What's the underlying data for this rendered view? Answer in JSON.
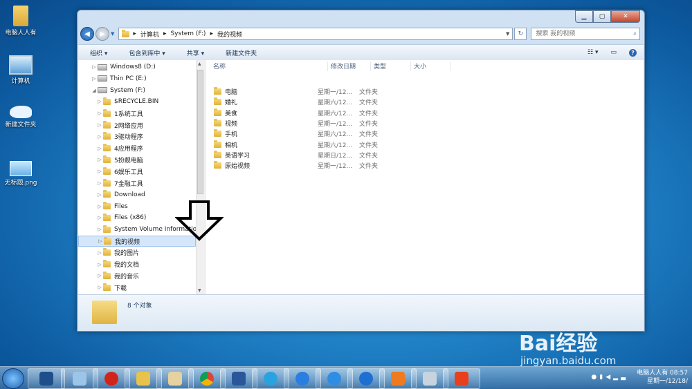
{
  "desktop": {
    "icons": [
      {
        "label": "电脑人人有"
      },
      {
        "label": "计算机"
      },
      {
        "label": "新建文件夹"
      },
      {
        "label": "无标题.png"
      }
    ]
  },
  "window": {
    "caption_buttons": [
      "minimize-icon",
      "maximize-icon",
      "close-icon"
    ],
    "address": {
      "crumbs": [
        "计算机",
        "System (F:)",
        "我的视频"
      ]
    },
    "search": {
      "placeholder": "搜索 我的视频"
    },
    "toolbar": {
      "organize": "组织 ▾",
      "include_library": "包含到库中 ▾",
      "share": "共享 ▾",
      "new_folder": "新建文件夹"
    },
    "nav_tree": [
      {
        "label": "Windows8 (D:)",
        "type": "drive",
        "indent": 1
      },
      {
        "label": "Thin PC (E:)",
        "type": "drive",
        "indent": 1
      },
      {
        "label": "System (F:)",
        "type": "drive",
        "indent": 1,
        "expanded": true
      },
      {
        "label": "$RECYCLE.BIN",
        "type": "folder",
        "indent": 2
      },
      {
        "label": "1系统工具",
        "type": "folder",
        "indent": 2
      },
      {
        "label": "2网络应用",
        "type": "folder",
        "indent": 2
      },
      {
        "label": "3驱动程序",
        "type": "folder",
        "indent": 2
      },
      {
        "label": "4应用程序",
        "type": "folder",
        "indent": 2
      },
      {
        "label": "5扮靓电脑",
        "type": "folder",
        "indent": 2
      },
      {
        "label": "6娱乐工具",
        "type": "folder",
        "indent": 2
      },
      {
        "label": "7金融工具",
        "type": "folder",
        "indent": 2
      },
      {
        "label": "Download",
        "type": "folder",
        "indent": 2
      },
      {
        "label": "Files",
        "type": "folder",
        "indent": 2
      },
      {
        "label": "Files (x86)",
        "type": "folder",
        "indent": 2
      },
      {
        "label": "System Volume Information",
        "type": "folder",
        "indent": 2
      },
      {
        "label": "我的视频",
        "type": "folder",
        "indent": 2,
        "selected": true
      },
      {
        "label": "我的图片",
        "type": "folder",
        "indent": 2
      },
      {
        "label": "我的文档",
        "type": "folder",
        "indent": 2
      },
      {
        "label": "我的音乐",
        "type": "folder",
        "indent": 2
      },
      {
        "label": "下载",
        "type": "folder",
        "indent": 2
      }
    ],
    "columns": [
      "名称",
      "修改日期",
      "类型",
      "大小"
    ],
    "files": [
      {
        "name": "电脑",
        "date": "星期一/12...",
        "type": "文件夹"
      },
      {
        "name": "婚礼",
        "date": "星期六/12...",
        "type": "文件夹"
      },
      {
        "name": "美食",
        "date": "星期六/12...",
        "type": "文件夹"
      },
      {
        "name": "视频",
        "date": "星期一/12...",
        "type": "文件夹"
      },
      {
        "name": "手机",
        "date": "星期六/12...",
        "type": "文件夹"
      },
      {
        "name": "相机",
        "date": "星期六/12...",
        "type": "文件夹"
      },
      {
        "name": "英语学习",
        "date": "星期日/12...",
        "type": "文件夹"
      },
      {
        "name": "原始视频",
        "date": "星期一/12...",
        "type": "文件夹"
      }
    ],
    "status": "8 个对象"
  },
  "taskbar": {
    "clock_name": "电脑人人有 08:57",
    "clock_date": "星期一/12/18/"
  },
  "watermark": {
    "brand": "Bai经验",
    "url": "jingyan.baidu.com"
  },
  "colors": {
    "accent": "#2a66b4",
    "selection": "#d5e6fa"
  }
}
